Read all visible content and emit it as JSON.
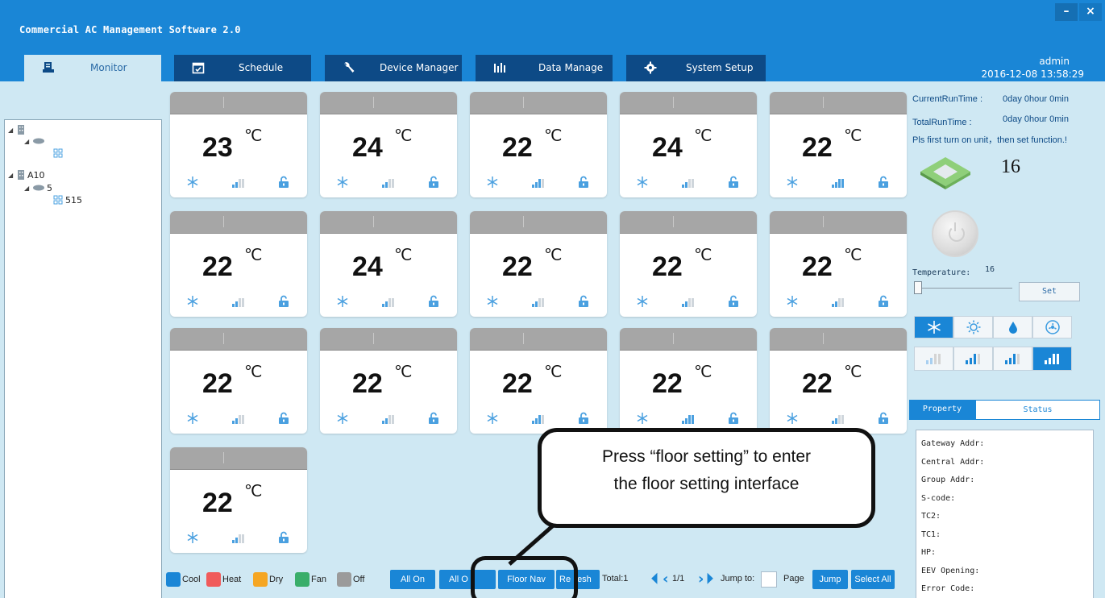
{
  "window": {
    "title": "Commercial AC Management Software 2.0",
    "minimize": "–",
    "close": "×"
  },
  "tabs": [
    {
      "label": "Monitor",
      "icon": "monitor-icon"
    },
    {
      "label": "Schedule",
      "icon": "calendar-icon"
    },
    {
      "label": "Device Manager",
      "icon": "wrench-icon"
    },
    {
      "label": "Data Manage",
      "icon": "bar-chart-icon"
    },
    {
      "label": "System Setup",
      "icon": "gear-icon"
    }
  ],
  "user": {
    "name": "admin",
    "datetime": "2016-12-08 13:58:29"
  },
  "tree": {
    "nodes": [
      {
        "label": ""
      },
      {
        "label": ""
      },
      {
        "label": ""
      },
      {
        "label": "A10"
      },
      {
        "label": "5"
      },
      {
        "label": "515"
      }
    ]
  },
  "units": [
    {
      "temp": "23",
      "unit": "℃",
      "fan_level": 1
    },
    {
      "temp": "24",
      "unit": "℃",
      "fan_level": 1
    },
    {
      "temp": "22",
      "unit": "℃",
      "fan_level": 2
    },
    {
      "temp": "24",
      "unit": "℃",
      "fan_level": 1
    },
    {
      "temp": "22",
      "unit": "℃",
      "fan_level": 3
    },
    {
      "temp": "22",
      "unit": "℃",
      "fan_level": 1
    },
    {
      "temp": "24",
      "unit": "℃",
      "fan_level": 1
    },
    {
      "temp": "22",
      "unit": "℃",
      "fan_level": 1
    },
    {
      "temp": "22",
      "unit": "℃",
      "fan_level": 1
    },
    {
      "temp": "22",
      "unit": "℃",
      "fan_level": 1
    },
    {
      "temp": "22",
      "unit": "℃",
      "fan_level": 1
    },
    {
      "temp": "22",
      "unit": "℃",
      "fan_level": 1
    },
    {
      "temp": "22",
      "unit": "℃",
      "fan_level": 2
    },
    {
      "temp": "22",
      "unit": "℃",
      "fan_level": 3
    },
    {
      "temp": "22",
      "unit": "℃",
      "fan_level": 1
    },
    {
      "temp": "22",
      "unit": "℃",
      "fan_level": 1
    }
  ],
  "right_panel": {
    "current_run_label": "CurrentRunTime :",
    "current_run_value": "0day 0hour 0min",
    "total_run_label": "TotalRunTime :",
    "total_run_value": "0day 0hour 0min",
    "notice": "Pls first turn on unit，then set function.!",
    "unit_number": "16",
    "temperature_label": "Temperature:",
    "temperature_value": "16",
    "set_label": "Set",
    "modes": [
      "cool-mode-icon",
      "heat-mode-icon",
      "dry-mode-icon",
      "fan-mode-icon"
    ],
    "selected_mode": 0,
    "fan_speeds": [
      "fan-speed-auto-icon",
      "fan-speed-low-icon",
      "fan-speed-mid-icon",
      "fan-speed-high-icon"
    ],
    "selected_fan": 3
  },
  "property_tabs": {
    "property": "Property",
    "status": "Status"
  },
  "properties": [
    "Gateway Addr:",
    "Central Addr:",
    "Group Addr:",
    "S-code:",
    "TC2:",
    "TC1:",
    "HP:",
    "EEV Opening:",
    "Error Code:"
  ],
  "legend": [
    {
      "label": "Cool",
      "color": "#1a86d6"
    },
    {
      "label": "Heat",
      "color": "#f05b5b"
    },
    {
      "label": "Dry",
      "color": "#f5a623"
    },
    {
      "label": "Fan",
      "color": "#3aae6a"
    },
    {
      "label": "Off",
      "color": "#9b9b9b"
    }
  ],
  "toolbar": {
    "all_on": "All On",
    "all_off": "All O",
    "floor_nav": "Floor Nav",
    "refresh": "Re",
    "refresh_tail": "esh",
    "total": "Total:1",
    "page_info": "1/1",
    "jump_to": "Jump to:",
    "page": "Page",
    "jump": "Jump",
    "select_all": "Select All"
  },
  "callout": {
    "line1": "Press “floor setting” to enter",
    "line2": "the floor setting interface"
  },
  "colors": {
    "header": "#1a86d6",
    "tab_dark": "#0d4a86",
    "content_bg": "#cfe8f3",
    "accent": "#1a86d6"
  }
}
